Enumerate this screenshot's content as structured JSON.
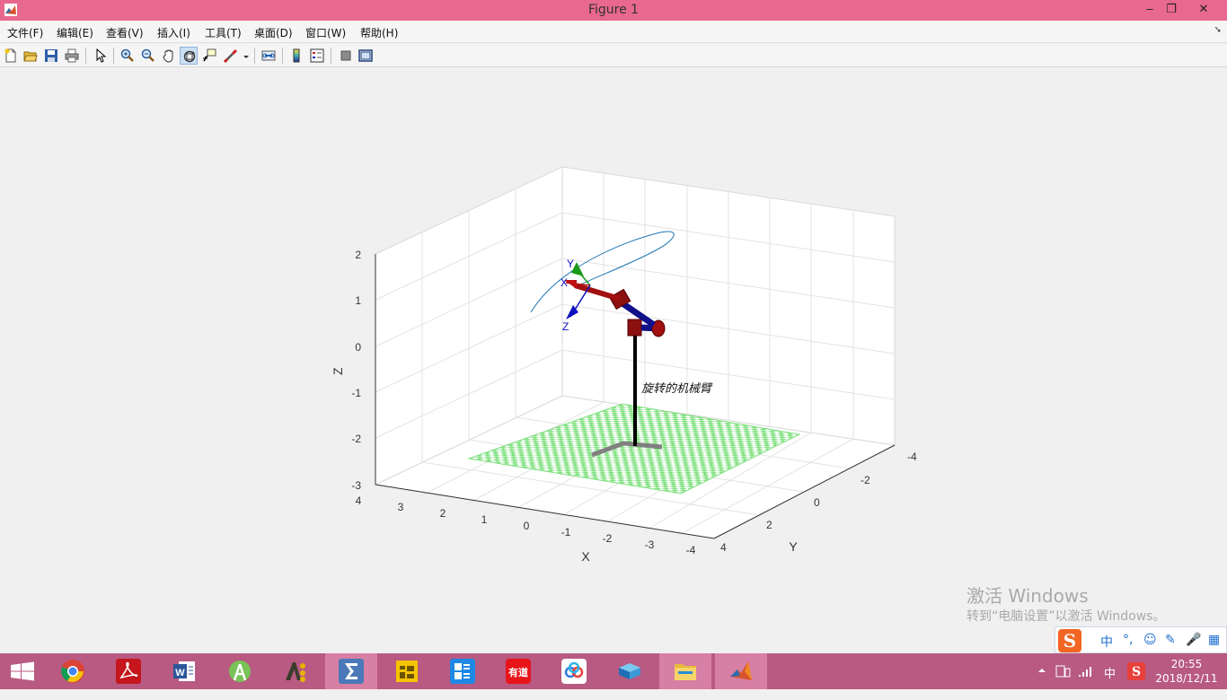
{
  "window": {
    "title": "Figure 1",
    "minimize": "‒",
    "maximize": "❐",
    "close": "✕"
  },
  "menu": {
    "items": [
      "文件(F)",
      "编辑(E)",
      "查看(V)",
      "插入(I)",
      "工具(T)",
      "桌面(D)",
      "窗口(W)",
      "帮助(H)"
    ]
  },
  "toolbar": {
    "buttons": [
      "new-figure-icon",
      "open-file-icon",
      "save-icon",
      "print-icon",
      "select-arrow-icon",
      "zoom-in-icon",
      "zoom-out-icon",
      "pan-hand-icon",
      "rotate-3d-icon",
      "data-cursor-icon",
      "brush-icon",
      "link-plot-icon",
      "colorbar-icon",
      "legend-icon",
      "hide-plot-tools-icon",
      "show-plot-tools-icon"
    ],
    "active": "rotate-3d-icon"
  },
  "plot": {
    "annotation": "旋转的机械臂",
    "x_label": "X",
    "y_label": "Y",
    "z_label": "Z",
    "z_ticks": [
      "2",
      "1",
      "0",
      "-1",
      "-2",
      "-3"
    ],
    "x_ticks": [
      "4",
      "3",
      "2",
      "1",
      "0",
      "-1",
      "-2",
      "-3",
      "-4"
    ],
    "y_ticks": [
      "-4",
      "-2",
      "0",
      "2",
      "4"
    ],
    "frame_labels": {
      "x": "X",
      "y": "Y",
      "z": "Z"
    },
    "colors": {
      "floor": "#7fe07f",
      "link_red": "#a01010",
      "link_blue": "#10108a",
      "trajectory": "#1f77b4",
      "pillar": "#000000",
      "base": "#808080"
    }
  },
  "watermark": {
    "line1": "激活 Windows",
    "line2": "转到“电脑设置”以激活 Windows。"
  },
  "ime": {
    "logo": "S",
    "items": [
      "中",
      "°,",
      "☺",
      "✎",
      "🎤",
      "▦"
    ]
  },
  "taskbar": {
    "apps": [
      "windows-start",
      "chrome",
      "acrobat",
      "word",
      "android-studio",
      "ae",
      "sigma-app",
      "vm-app",
      "tiles-app",
      "youdao",
      "baidu-cloud",
      "sketchup",
      "file-explorer",
      "matlab"
    ],
    "youdao_label": "有道",
    "tray_lang": "中",
    "time": "20:55",
    "date": "2018/12/11"
  }
}
